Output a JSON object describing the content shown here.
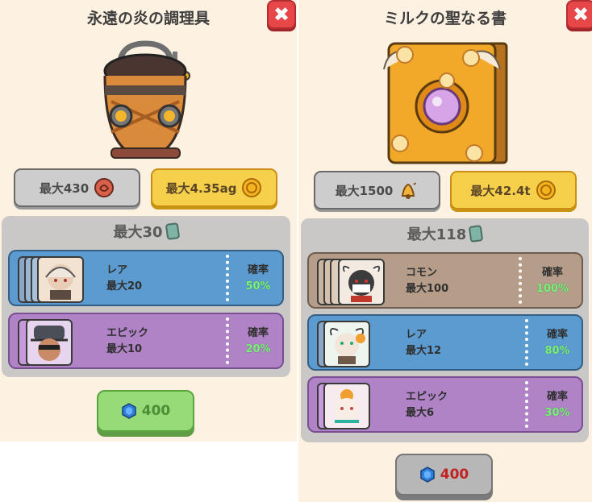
{
  "left": {
    "title": "永遠の炎の調理具",
    "close_glyph": "✖",
    "stat_one": "最大430",
    "stat_two": "最大4.35ag",
    "box_title": "最大30",
    "rows": [
      {
        "rarity": "レア",
        "max": "最大20",
        "chance_label": "確率",
        "chance": "50%"
      },
      {
        "rarity": "エピック",
        "max": "最大10",
        "chance_label": "確率",
        "chance": "20%"
      }
    ],
    "price": "400"
  },
  "right": {
    "title": "ミルクの聖なる書",
    "close_glyph": "✖",
    "stat_one": "最大1500",
    "stat_two": "最大42.4t",
    "box_title": "最大118",
    "rows": [
      {
        "rarity": "コモン",
        "max": "最大100",
        "chance_label": "確率",
        "chance": "100%"
      },
      {
        "rarity": "レア",
        "max": "最大12",
        "chance_label": "確率",
        "chance": "80%"
      },
      {
        "rarity": "エピック",
        "max": "最大6",
        "chance_label": "確率",
        "chance": "30%"
      }
    ],
    "price": "400"
  },
  "icons": {
    "close": "close-icon",
    "seed": "seed-icon",
    "coin": "gold-coin-icon",
    "bell": "bell-icon",
    "card": "card-icon",
    "gem": "blue-gem-icon"
  },
  "colors": {
    "panel_bg": "#fdf1e1",
    "blue_row": "#5b9bd0",
    "purple_row": "#b083c7",
    "brown_row": "#b59d8a",
    "chance_green": "#7cf07c",
    "price_red": "#c22222",
    "price_green": "#4c8d38"
  }
}
